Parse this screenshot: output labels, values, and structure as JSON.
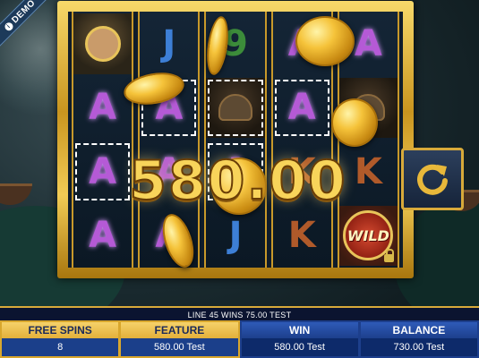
{
  "demo_badge": {
    "label": "DEMO"
  },
  "reels": [
    [
      {
        "symbol": "pic",
        "icon": "heroine-icon"
      },
      {
        "symbol": "A"
      },
      {
        "symbol": "A",
        "highlight": true
      },
      {
        "symbol": "A"
      }
    ],
    [
      {
        "symbol": "J"
      },
      {
        "symbol": "A",
        "highlight": true
      },
      {
        "symbol": "A"
      },
      {
        "symbol": "A"
      }
    ],
    [
      {
        "symbol": "9"
      },
      {
        "symbol": "viking",
        "icon": "viking-icon",
        "highlight": true
      },
      {
        "symbol": "A",
        "highlight": true
      },
      {
        "symbol": "J"
      }
    ],
    [
      {
        "symbol": "A"
      },
      {
        "symbol": "A",
        "highlight": true
      },
      {
        "symbol": "K"
      },
      {
        "symbol": "K"
      }
    ],
    [
      {
        "symbol": "A"
      },
      {
        "symbol": "viking",
        "icon": "viking-icon"
      },
      {
        "symbol": "K"
      },
      {
        "symbol": "wild",
        "label": "WILD",
        "icon": "lock-icon"
      }
    ]
  ],
  "win_amount": "580.00",
  "spin_button": {
    "icon": "refresh-icon"
  },
  "line_info": "LINE 45 WINS 75.00 TEST",
  "hud": {
    "free_spins": {
      "label": "FREE SPINS",
      "value": "8"
    },
    "feature": {
      "label": "FEATURE",
      "value": "580.00 Test"
    },
    "win": {
      "label": "WIN",
      "value": "580.00 Test"
    },
    "balance": {
      "label": "BALANCE",
      "value": "730.00 Test"
    }
  },
  "colors": {
    "frame_gold": "#d8aa3a",
    "symbol_a": "#b55ad6",
    "hud_blue": "#1d3f8c"
  }
}
